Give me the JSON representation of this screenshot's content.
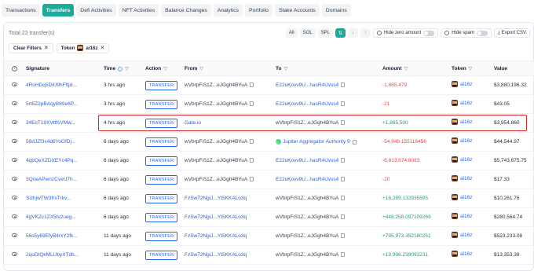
{
  "tabs": [
    "Transactions",
    "Transfers",
    "Defi Activities",
    "NFT Activities",
    "Balance Changes",
    "Analytics",
    "Portfolio",
    "Stake Accounts",
    "Domains"
  ],
  "active_tab": "Transfers",
  "summary": {
    "total_label": "Total 23 transfer(s)"
  },
  "controls": {
    "asset_filters": [
      "All",
      "SOL",
      "SPL"
    ],
    "hide_zero": "Hide zero amount",
    "hide_spam": "Hide spam",
    "export": "Export CSV"
  },
  "filters": {
    "clear_label": "Clear Filters",
    "token_label": "Token",
    "token_value": "ai16z"
  },
  "columns": {
    "signature": "Signature",
    "time": "Time",
    "action": "Action",
    "from": "From",
    "to": "To",
    "amount": "Amount",
    "token": "Token",
    "value": "Value"
  },
  "rows": [
    {
      "sig": "4RoHDq5DiU9hFftjd...",
      "time": "3 hrs ago",
      "action": "TRANSFER",
      "from": "wVbrpFiS1Z...eJGgh4BYuA",
      "from_link": false,
      "to": "E22uKovv9U...hasR4Uvss4",
      "to_link": true,
      "amount": "-1,865,479",
      "sign": "neg",
      "token": "ai16z",
      "value": "$3,880,196.32"
    },
    {
      "sig": "5rt5Z2pBAqyB69e6P...",
      "time": "3 hrs ago",
      "action": "TRANSFER",
      "from": "wVbrpFiS1Z...eJGgh4BYuA",
      "from_link": false,
      "to": "E22uKovv9U...hasR4Uvss4",
      "to_link": true,
      "amount": "-21",
      "sign": "neg",
      "token": "ai16z",
      "value": "$43.05"
    },
    {
      "sig": "34EsT19XVttfsVMw...",
      "time": "4 hrs ago",
      "action": "TRANSFER",
      "from": "Gate.io",
      "from_link": true,
      "to": "wVbrpFiS1Z...eJGgh4BYuA",
      "to_link": false,
      "amount": "+1,865,500",
      "sign": "pos",
      "token": "ai16z",
      "value": "$3,954,860"
    },
    {
      "sig": "58dJZf3x4d8YoGfDj...",
      "time": "6 days ago",
      "action": "TRANSFER",
      "from": "wVbrpFiS1Z...eJGgh4BYuA",
      "from_link": false,
      "to": "Jupiter Aggregator Authority 9",
      "to_link": true,
      "to_jup": true,
      "amount": "-54,949.155116456",
      "sign": "neg",
      "token": "ai16z",
      "value": "$44,544.97"
    },
    {
      "sig": "4qbQeXZDXEYc4Pq...",
      "time": "6 days ago",
      "action": "TRANSFER",
      "from": "wVbrpFiS1Z...eJGgh4BYuA",
      "from_link": false,
      "to": "E22uKovv9U...hasR4Uvss4",
      "to_link": true,
      "amount": "-6,813,674.8083",
      "sign": "neg",
      "token": "ai16z",
      "value": "$5,743,675.75"
    },
    {
      "sig": "3QneAPwnzCveU7h...",
      "time": "6 days ago",
      "action": "TRANSFER",
      "from": "wVbrpFiS1Z...eJGgh4BYuA",
      "from_link": false,
      "to": "E22uKovv9U...hasR4Uvss4",
      "to_link": true,
      "amount": "-20",
      "sign": "neg",
      "token": "ai16z",
      "value": "$17.33"
    },
    {
      "sig": "SizhjwTW3frsTrkv...",
      "time": "6 days ago",
      "action": "TRANSFER",
      "from": "FzSw72NgiJ...Yt5KKALo3q",
      "from_link": true,
      "to": "wVbrpFiS1Z...eJGgh4BYuA",
      "to_link": false,
      "amount": "+16,289.132935595",
      "sign": "pos",
      "token": "ai16z",
      "value": "$10,261.76"
    },
    {
      "sig": "4gVKZc1ZX5tv2ueg...",
      "time": "6 days ago",
      "action": "TRANSFER",
      "from": "FzSw72NgiJ...Yt5KKALo3q",
      "from_link": true,
      "to": "wVbrpFiS1Z...eJGgh4BYuA",
      "to_link": false,
      "amount": "+448,258.097109269",
      "sign": "pos",
      "token": "ai16z",
      "value": "$280,564.74"
    },
    {
      "sig": "56c5y69EfyB4rxY2fk...",
      "time": "11 days ago",
      "action": "TRANSFER",
      "from": "FzSw72NgiJ...Yt5KKALo3q",
      "from_link": true,
      "to": "wVbrpFiS1Z...eJGgh4BYuA",
      "to_link": false,
      "amount": "+795,973.352180251",
      "sign": "pos",
      "token": "ai16z",
      "value": "$523,233.08"
    },
    {
      "sig": "2qoDtQkMLUbyXTdh...",
      "time": "11 days ago",
      "action": "TRANSFER",
      "from": "FzSw72NgiJ...Yt5KKALo3q",
      "from_link": true,
      "to": "wVbrpFiS1Z...eJGgh4BYuA",
      "to_link": false,
      "amount": "+19,906.239093231",
      "sign": "pos",
      "token": "ai16z",
      "value": "$13,353.38"
    }
  ],
  "highlighted_row": 2,
  "colors": {
    "accent": "#1eaa9b",
    "link": "#2563eb",
    "negative": "#ef4444",
    "positive": "#22a06b",
    "highlight": "#dc2626"
  }
}
